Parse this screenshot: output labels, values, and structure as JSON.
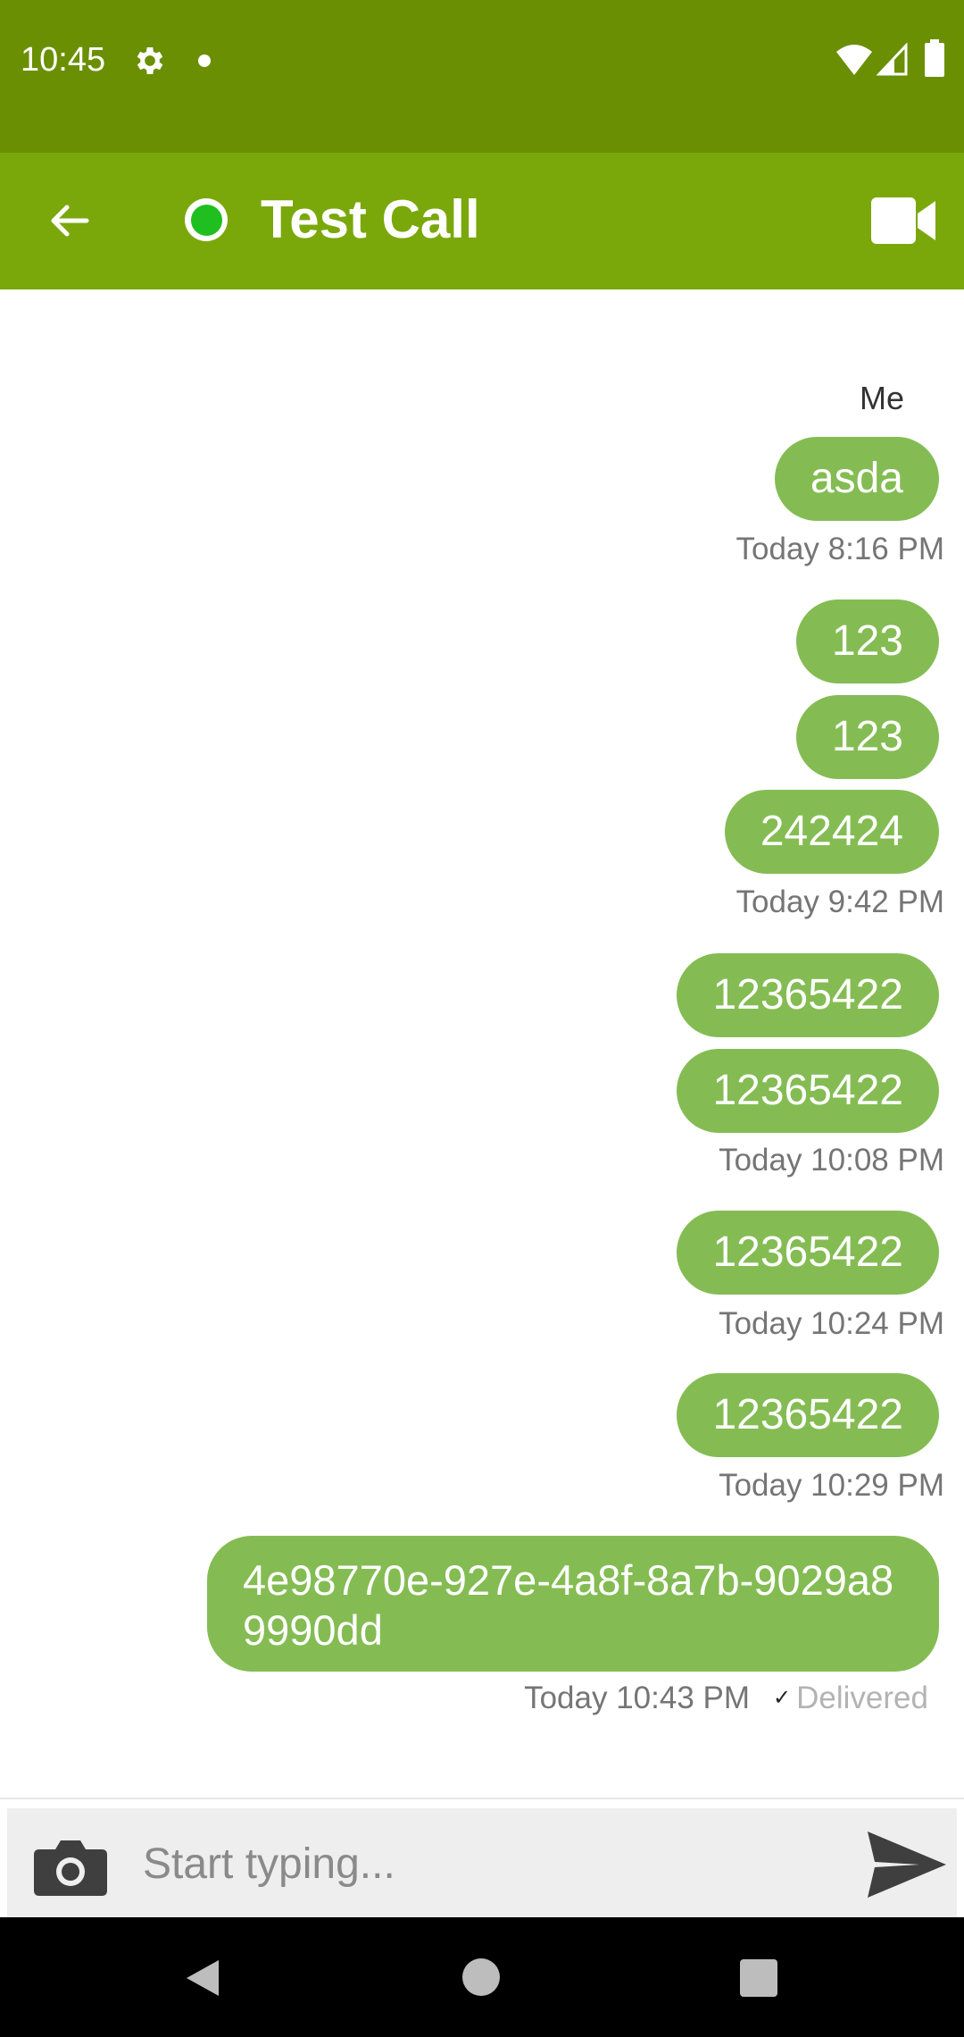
{
  "status_bar": {
    "time": "10:45",
    "icons": [
      "gear-icon",
      "dot-icon",
      "wifi-icon",
      "signal-icon",
      "battery-icon"
    ]
  },
  "app_bar": {
    "title": "Test Call",
    "presence_status_color": "#1fbf1f",
    "background_color": "#7aa80b",
    "icons": [
      "back-arrow-icon",
      "presence-icon",
      "video-camera-icon"
    ]
  },
  "chat": {
    "sender_label": "Me",
    "bubble_color": "#84bc53",
    "messages": [
      {
        "text": "asda"
      },
      {
        "text": "123"
      },
      {
        "text": "123"
      },
      {
        "text": "242424"
      },
      {
        "text": "12365422"
      },
      {
        "text": "12365422"
      },
      {
        "text": "12365422"
      },
      {
        "text": "12365422"
      },
      {
        "text": "4e98770e-927e-4a8f-8a7b-9029a89990dd"
      }
    ],
    "timestamps": [
      "Today 8:16 PM",
      "Today 9:42 PM",
      "Today 10:08 PM",
      "Today 10:24 PM",
      "Today 10:29 PM",
      "Today 10:43 PM"
    ],
    "last_message_status": "Delivered"
  },
  "composer": {
    "placeholder": "Start typing...",
    "value": "",
    "icons": [
      "camera-icon",
      "send-icon"
    ]
  },
  "nav_bar": {
    "icons": [
      "nav-back-icon",
      "nav-home-icon",
      "nav-recents-icon"
    ]
  }
}
